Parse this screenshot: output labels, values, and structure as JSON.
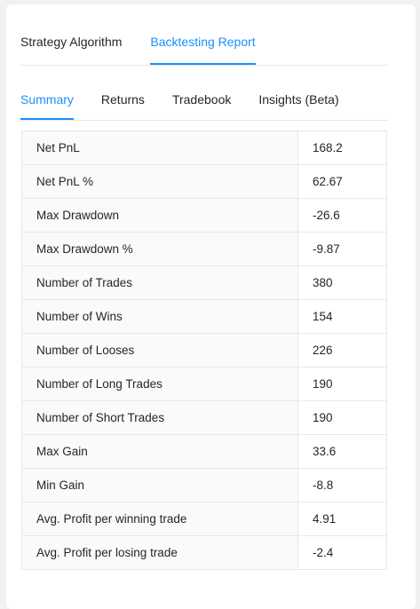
{
  "top_tabs": [
    {
      "label": "Strategy Algorithm",
      "active": false
    },
    {
      "label": "Backtesting Report",
      "active": true
    }
  ],
  "sub_tabs": [
    {
      "label": "Summary",
      "active": true
    },
    {
      "label": "Returns",
      "active": false
    },
    {
      "label": "Tradebook",
      "active": false
    },
    {
      "label": "Insights (Beta)",
      "active": false
    }
  ],
  "summary": [
    {
      "label": "Net PnL",
      "value": "168.2"
    },
    {
      "label": "Net PnL %",
      "value": "62.67"
    },
    {
      "label": "Max Drawdown",
      "value": "-26.6"
    },
    {
      "label": "Max Drawdown %",
      "value": "-9.87"
    },
    {
      "label": "Number of Trades",
      "value": "380"
    },
    {
      "label": "Number of Wins",
      "value": "154"
    },
    {
      "label": "Number of Looses",
      "value": "226"
    },
    {
      "label": "Number of Long Trades",
      "value": "190"
    },
    {
      "label": "Number of Short Trades",
      "value": "190"
    },
    {
      "label": "Max Gain",
      "value": "33.6"
    },
    {
      "label": "Min Gain",
      "value": "-8.8"
    },
    {
      "label": "Avg. Profit per winning trade",
      "value": "4.91"
    },
    {
      "label": "Avg. Profit per losing trade",
      "value": "-2.4"
    }
  ]
}
